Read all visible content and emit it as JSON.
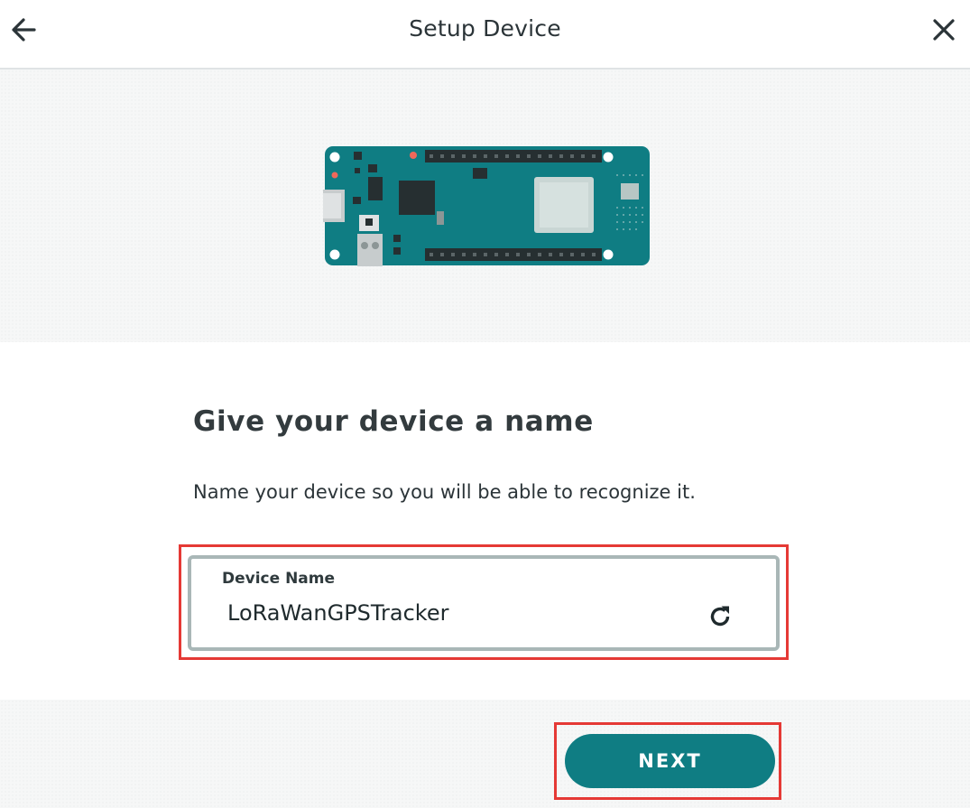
{
  "header": {
    "title": "Setup Device",
    "back_icon": "arrow-left-icon",
    "close_icon": "close-icon"
  },
  "hero": {
    "image": "arduino-board-illustration",
    "board_color": "#0f7d83"
  },
  "main": {
    "heading": "Give your device a name",
    "description": "Name your device so you will be able to recognize it.",
    "device_name_field": {
      "label": "Device Name",
      "value": "LoRaWanGPSTracker",
      "refresh_icon": "refresh-icon"
    }
  },
  "footer": {
    "next_label": "NEXT"
  },
  "colors": {
    "accent": "#0f7d83",
    "highlight": "#e53935",
    "field_border": "#a9b7b7"
  }
}
